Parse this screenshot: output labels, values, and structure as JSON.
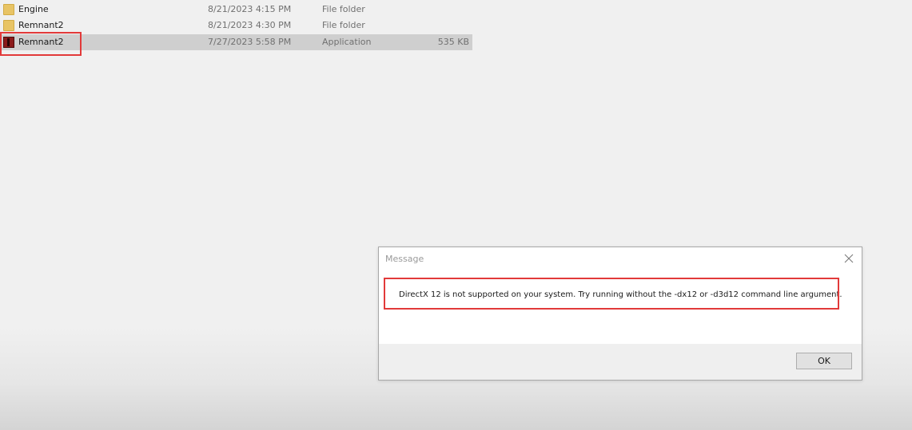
{
  "files": [
    {
      "name": "Engine",
      "date": "8/21/2023 4:15 PM",
      "type": "File folder",
      "size": "",
      "icon": "folder-icon"
    },
    {
      "name": "Remnant2",
      "date": "8/21/2023 4:30 PM",
      "type": "File folder",
      "size": "",
      "icon": "folder-icon"
    },
    {
      "name": "Remnant2",
      "date": "7/27/2023 5:58 PM",
      "type": "Application",
      "size": "535 KB",
      "icon": "app-icon"
    }
  ],
  "dialog": {
    "title": "Message",
    "message": "DirectX 12 is not supported on your system. Try running without the -dx12 or -d3d12 command line argument.",
    "ok_label": "OK"
  },
  "colors": {
    "highlight": "#e23a3a",
    "selected_row": "#cfcfcf",
    "folder": "#e8c465",
    "app_icon": "#8b1a1a"
  }
}
